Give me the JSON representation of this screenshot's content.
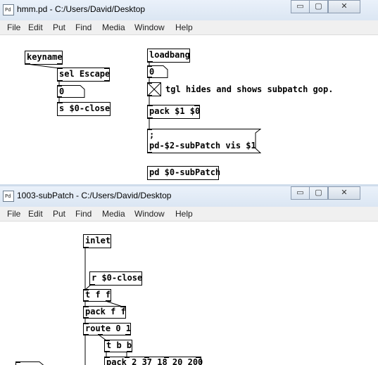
{
  "window1": {
    "title": "hmm.pd  - C:/Users/David/Desktop",
    "icon_label": "Pd",
    "menu": [
      "File",
      "Edit",
      "Put",
      "Find",
      "Media",
      "Window",
      "Help"
    ],
    "objects": {
      "keyname": "keyname",
      "sel_escape": "sel Escape",
      "num_left": "0",
      "s_close": "s $0-close",
      "loadbang": "loadbang",
      "num_right": "0",
      "pack": "pack $1 $0",
      "msg_line1": ";",
      "msg_line2": "pd-$2-subPatch vis $1",
      "pd_sub": "pd $0-subPatch"
    },
    "comment": "tgl hides and shows subpatch gop."
  },
  "window2": {
    "title": "1003-subPatch  - C:/Users/David/Desktop",
    "icon_label": "Pd",
    "menu": [
      "File",
      "Edit",
      "Put",
      "Find",
      "Media",
      "Window",
      "Help"
    ],
    "objects": {
      "inlet": "inlet",
      "r_close": "r $0-close",
      "tff": "t f f",
      "packff": "pack f f",
      "route": "route 0 1",
      "tbb": "t b b",
      "pack_nums": "pack 2 37 18 20 200"
    }
  },
  "window_buttons": {
    "minimize": "▭",
    "maximize": "▢",
    "close": "✕"
  }
}
